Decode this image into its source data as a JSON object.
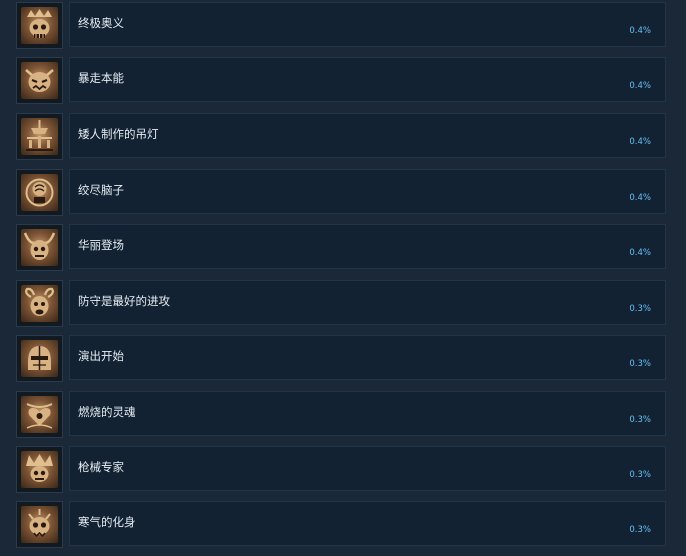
{
  "achievements": [
    {
      "name": "终极奥义",
      "percent": "0.4%",
      "icon": "skull-crown-icon"
    },
    {
      "name": "暴走本能",
      "percent": "0.4%",
      "icon": "beast-face-icon"
    },
    {
      "name": "矮人制作的吊灯",
      "percent": "0.4%",
      "icon": "chandelier-icon"
    },
    {
      "name": "绞尽脑子",
      "percent": "0.4%",
      "icon": "brain-icon"
    },
    {
      "name": "华丽登场",
      "percent": "0.4%",
      "icon": "horned-mask-icon"
    },
    {
      "name": "防守是最好的进攻",
      "percent": "0.3%",
      "icon": "ram-face-icon"
    },
    {
      "name": "演出开始",
      "percent": "0.3%",
      "icon": "helmet-icon"
    },
    {
      "name": "燃烧的灵魂",
      "percent": "0.3%",
      "icon": "heart-flame-icon"
    },
    {
      "name": "枪械专家",
      "percent": "0.3%",
      "icon": "spiked-crown-icon"
    },
    {
      "name": "寒气的化身",
      "percent": "0.3%",
      "icon": "ice-skull-icon"
    }
  ],
  "colors": {
    "background": "#1b2838",
    "card": "#132233",
    "percent": "#66c0f4",
    "text": "#e6edf3"
  }
}
